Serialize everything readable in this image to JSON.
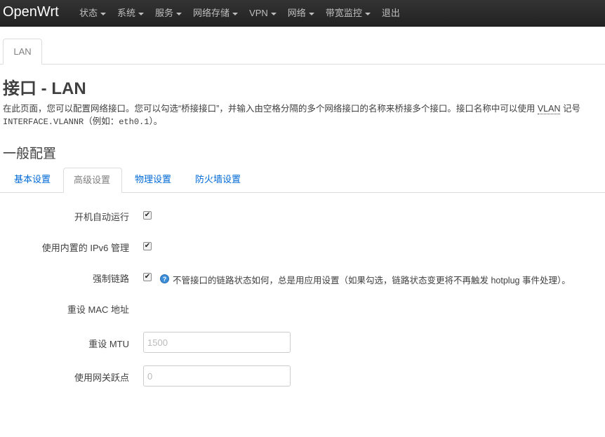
{
  "navbar": {
    "brand": "OpenWrt",
    "items": [
      {
        "label": "状态",
        "has_caret": true
      },
      {
        "label": "系统",
        "has_caret": true
      },
      {
        "label": "服务",
        "has_caret": true
      },
      {
        "label": "网络存储",
        "has_caret": true
      },
      {
        "label": "VPN",
        "has_caret": true
      },
      {
        "label": "网络",
        "has_caret": true
      },
      {
        "label": "带宽监控",
        "has_caret": true
      },
      {
        "label": "退出",
        "has_caret": false
      }
    ]
  },
  "page_tabs": [
    {
      "label": "LAN",
      "active": true
    }
  ],
  "page": {
    "title": "接口 - LAN",
    "description_part1": "在此页面，您可以配置网络接口。您可以勾选“桥接接口”，并输入由空格分隔的多个网络接口的名称来桥接多个接口。接口名称中可以使用 ",
    "description_abbr": "VLAN",
    "description_part2": " 记号",
    "description_code": "INTERFACE.VLANNR",
    "description_part3": "（例如：",
    "description_example": "eth0.1",
    "description_part4": "）。"
  },
  "section": {
    "title": "一般配置",
    "tabs": [
      {
        "label": "基本设置",
        "active": false
      },
      {
        "label": "高级设置",
        "active": true
      },
      {
        "label": "物理设置",
        "active": false
      },
      {
        "label": "防火墙设置",
        "active": false
      }
    ]
  },
  "form": {
    "autostart": {
      "label": "开机自动运行",
      "checked": true
    },
    "ipv6_builtin": {
      "label": "使用内置的 IPv6 管理",
      "checked": true
    },
    "force_link": {
      "label": "强制链路",
      "checked": true,
      "help": "不管接口的链路状态如何，总是用应用设置（如果勾选，链路状态变更将不再触发 hotplug 事件处理）。"
    },
    "mac": {
      "label": "重设 MAC 地址"
    },
    "mtu": {
      "label": "重设 MTU",
      "value": "",
      "placeholder": "1500"
    },
    "metric": {
      "label": "使用网关跃点",
      "value": "",
      "placeholder": "0"
    }
  },
  "colors": {
    "navbar_bg": "#222222",
    "link": "#0069d6",
    "help_icon": "#3b8ed8"
  }
}
